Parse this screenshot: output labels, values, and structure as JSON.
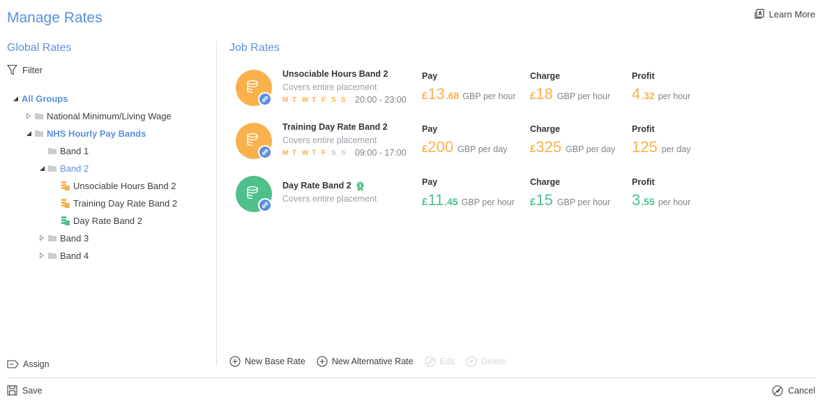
{
  "header": {
    "title": "Manage Rates",
    "learn_more": "Learn More"
  },
  "global": {
    "heading": "Global Rates",
    "filter_label": "Filter",
    "tree": [
      {
        "label": "All Groups",
        "state": "expanded",
        "active": true,
        "bold": true
      },
      {
        "label": "National Minimum/Living Wage",
        "state": "collapsed"
      },
      {
        "label": "NHS Hourly Pay Bands",
        "state": "expanded",
        "active": true,
        "bold": true
      },
      {
        "label": "Band 1",
        "state": "leaf-folder"
      },
      {
        "label": "Band 2",
        "state": "expanded",
        "active": true
      },
      {
        "label": "Unsociable Hours Band 2",
        "state": "rate",
        "color": "#f8b24c"
      },
      {
        "label": "Training Day Rate Band 2",
        "state": "rate",
        "color": "#f8b24c"
      },
      {
        "label": "Day Rate Band 2",
        "state": "rate",
        "color": "#4fc08b"
      },
      {
        "label": "Band 3",
        "state": "collapsed"
      },
      {
        "label": "Band 4",
        "state": "collapsed"
      }
    ],
    "assign_label": "Assign"
  },
  "job": {
    "heading": "Job Rates",
    "rates": [
      {
        "name": "Unsociable Hours Band 2",
        "description": "Covers entire placement",
        "color": "#f8b24c",
        "days": [
          "M",
          "T",
          "W",
          "T",
          "F",
          "S",
          "S"
        ],
        "days_on": [
          true,
          true,
          true,
          true,
          true,
          true,
          true
        ],
        "hours": "20:00 - 23:00",
        "pay": {
          "label": "Pay",
          "currency": "£",
          "whole": "13",
          "fraction": ".68",
          "unit": "GBP per hour"
        },
        "charge": {
          "label": "Charge",
          "currency": "£",
          "whole": "18",
          "fraction": "",
          "unit": "GBP per hour"
        },
        "profit": {
          "label": "Profit",
          "currency": "",
          "whole": "4",
          "fraction": ".32",
          "unit": "per hour"
        }
      },
      {
        "name": "Training Day Rate Band 2",
        "description": "Covers entire placement",
        "color": "#f8b24c",
        "days": [
          "M",
          "T",
          "W",
          "T",
          "F",
          "S",
          "S"
        ],
        "days_on": [
          true,
          true,
          true,
          true,
          true,
          false,
          false
        ],
        "hours": "09:00 - 17:00",
        "pay": {
          "label": "Pay",
          "currency": "£",
          "whole": "200",
          "fraction": "",
          "unit": "GBP per day"
        },
        "charge": {
          "label": "Charge",
          "currency": "£",
          "whole": "325",
          "fraction": "",
          "unit": "GBP per day"
        },
        "profit": {
          "label": "Profit",
          "currency": "",
          "whole": "125",
          "fraction": "",
          "unit": "per day"
        }
      },
      {
        "name": "Day Rate Band 2",
        "description": "Covers entire placement",
        "color": "#4fc08b",
        "award_icon": "award-icon",
        "pay": {
          "label": "Pay",
          "currency": "£",
          "whole": "11",
          "fraction": ".45",
          "unit": "GBP per hour"
        },
        "charge": {
          "label": "Charge",
          "currency": "£",
          "whole": "15",
          "fraction": "",
          "unit": "GBP per hour"
        },
        "profit": {
          "label": "Profit",
          "currency": "",
          "whole": "3",
          "fraction": ".55",
          "unit": "per hour"
        }
      }
    ],
    "actions": {
      "new_base": "New Base Rate",
      "new_alt": "New Alternative Rate",
      "edit": "Edit",
      "delete": "Delete"
    }
  },
  "footer": {
    "save": "Save",
    "cancel": "Cancel"
  }
}
